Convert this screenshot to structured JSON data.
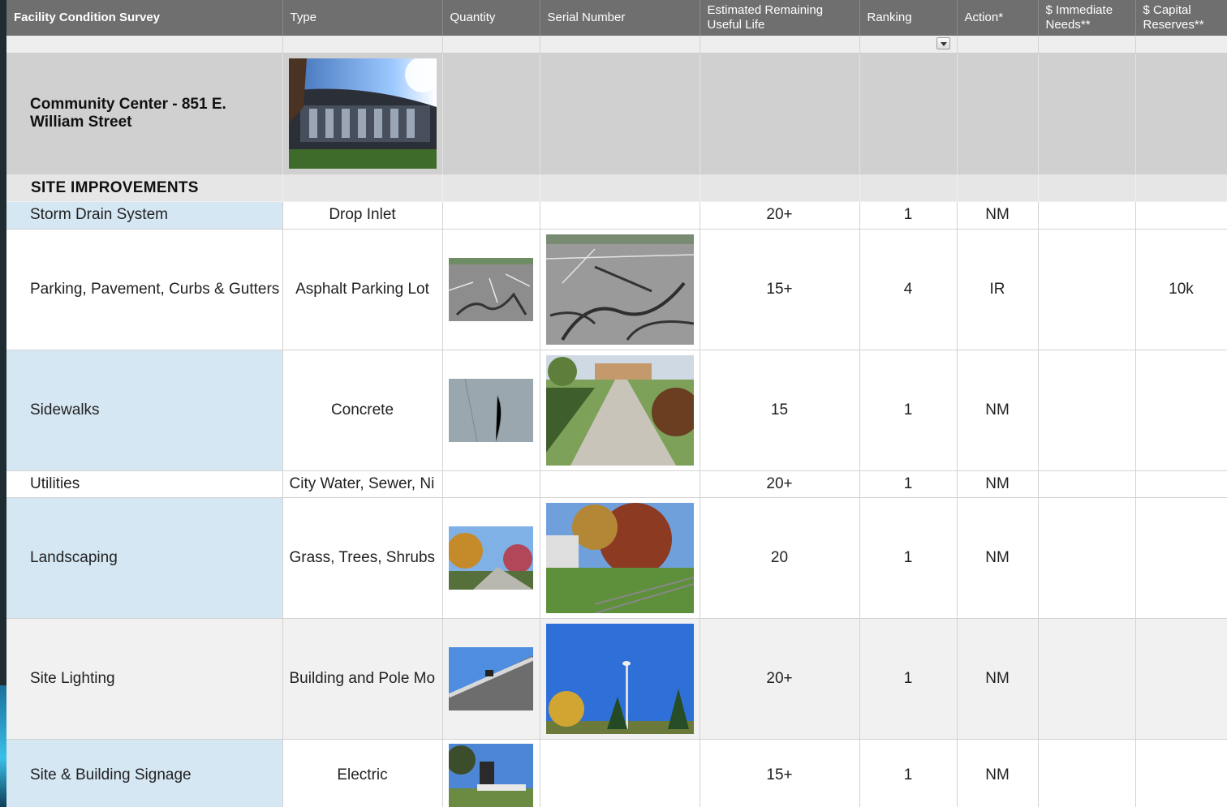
{
  "headers": {
    "col1": "Facility Condition Survey",
    "col2": "Type",
    "col3": "Quantity",
    "col4": "Serial Number",
    "col5": "Estimated Remaining Useful Life",
    "col6": "Ranking",
    "col7": "Action*",
    "col8": "$ Immediate Needs**",
    "col9": "$ Capital Reserves**"
  },
  "facility": {
    "name": "Community Center - 851 E. William Street"
  },
  "section": {
    "title": "SITE IMPROVEMENTS"
  },
  "rows": [
    {
      "system": "Storm Drain System",
      "type": "Drop Inlet",
      "life": "20+",
      "ranking": "1",
      "action": "NM",
      "immediate": "",
      "capital": ""
    },
    {
      "system": "Parking, Pavement, Curbs & Gutters",
      "type": "Asphalt Parking Lot",
      "life": "15+",
      "ranking": "4",
      "action": "IR",
      "immediate": "",
      "capital": "10k"
    },
    {
      "system": "Sidewalks",
      "type": "Concrete",
      "life": "15",
      "ranking": "1",
      "action": "NM",
      "immediate": "",
      "capital": ""
    },
    {
      "system": "Utilities",
      "type": "City Water, Sewer, Ni",
      "life": "20+",
      "ranking": "1",
      "action": "NM",
      "immediate": "",
      "capital": ""
    },
    {
      "system": "Landscaping",
      "type": "Grass, Trees, Shrubs",
      "life": "20",
      "ranking": "1",
      "action": "NM",
      "immediate": "",
      "capital": ""
    },
    {
      "system": "Site Lighting",
      "type": "Building and Pole Mo",
      "life": "20+",
      "ranking": "1",
      "action": "NM",
      "immediate": "",
      "capital": ""
    },
    {
      "system": "Site & Building Signage",
      "type": "Electric",
      "life": "15+",
      "ranking": "1",
      "action": "NM",
      "immediate": "",
      "capital": ""
    }
  ],
  "colors": {
    "header_bg": "#6f6f6f",
    "blue_cell": "#d6e7f4",
    "facility_bg": "#d0d0d0"
  }
}
